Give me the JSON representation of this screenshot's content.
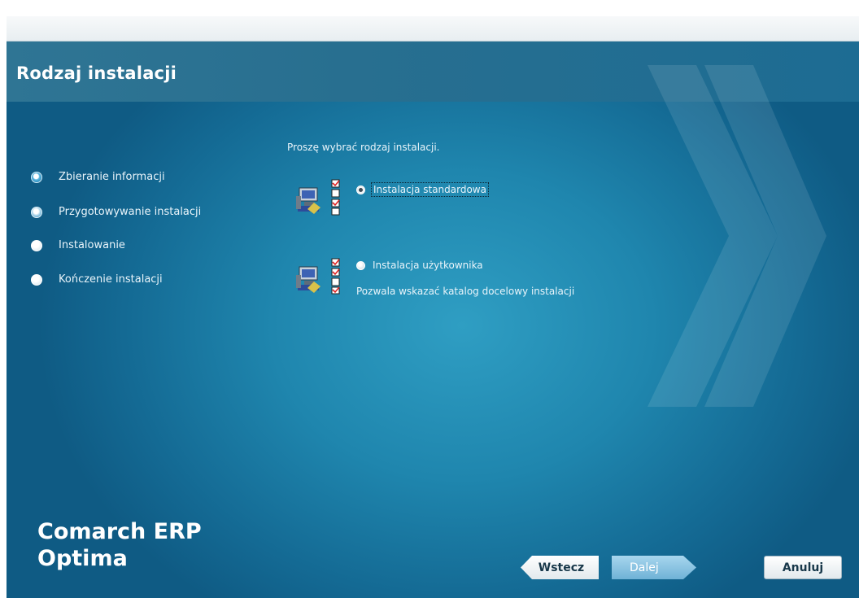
{
  "header": {
    "title": "Rodzaj instalacji"
  },
  "steps": [
    {
      "label": "Zbieranie informacji",
      "state": "active"
    },
    {
      "label": "Przygotowywanie instalacji",
      "state": "semi"
    },
    {
      "label": "Instalowanie",
      "state": "pending"
    },
    {
      "label": "Kończenie instalacji",
      "state": "pending"
    }
  ],
  "main": {
    "prompt": "Proszę wybrać rodzaj instalacji.",
    "options": [
      {
        "label": "Instalacja standardowa",
        "selected": true,
        "icon": "install-checklist-icon"
      },
      {
        "label": "Instalacja użytkownika",
        "selected": false,
        "description": "Pozwala wskazać katalog docelowy instalacji",
        "icon": "install-checklist-icon"
      }
    ]
  },
  "brand": {
    "line1": "Comarch ERP",
    "line2": "Optima"
  },
  "buttons": {
    "back": "Wstecz",
    "next": "Dalej",
    "cancel": "Anuluj"
  },
  "colors": {
    "accent": "#1f86ae",
    "header": "#2f7594"
  }
}
